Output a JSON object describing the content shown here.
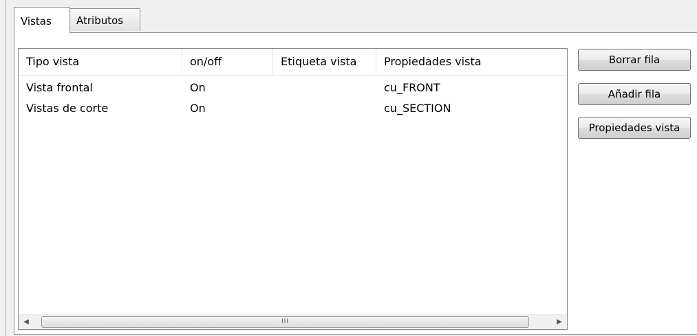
{
  "tabs": [
    {
      "label": "Vistas",
      "active": true
    },
    {
      "label": "Atributos",
      "active": false
    }
  ],
  "table": {
    "columns": [
      "Tipo vista",
      "on/off",
      "Etiqueta vista",
      "Propiedades vista"
    ],
    "rows": [
      [
        "Vista frontal",
        "On",
        "",
        "cu_FRONT"
      ],
      [
        "Vistas de corte",
        "On",
        "",
        "cu_SECTION"
      ]
    ]
  },
  "scrollbar": {
    "left_arrow": "◀",
    "right_arrow": "▶",
    "grip": "III"
  },
  "buttons": {
    "delete_row": "Borrar fila",
    "add_row": "Añadir fila",
    "view_properties": "Propiedades vista"
  }
}
